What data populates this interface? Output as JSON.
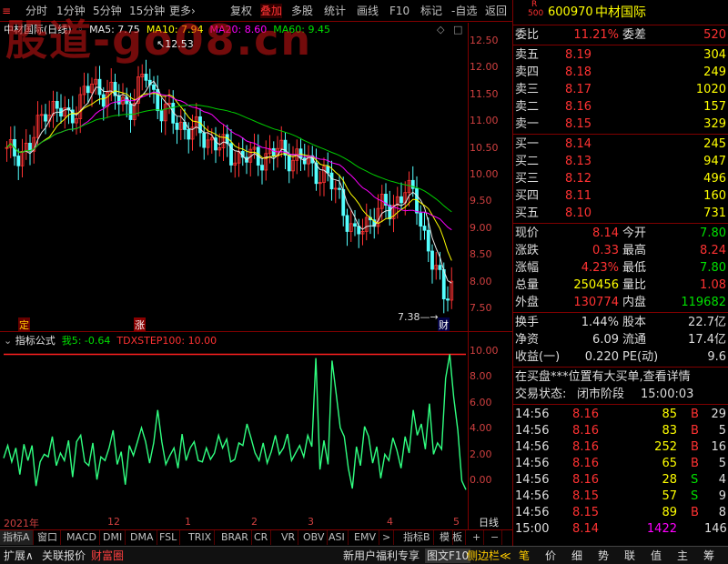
{
  "toolbar": {
    "items": [
      "分时",
      "1分钟",
      "5分钟",
      "15分钟",
      "更多›",
      "复权",
      "叠加",
      "多股",
      "统计",
      "画线",
      "F10",
      "标记",
      "-自选",
      "返回"
    ]
  },
  "chart": {
    "stock_title": "中材国际(日线)",
    "ma5": "MA5: 7.75",
    "ma10": "MA10: 7.94",
    "ma20": "MA20: 8.60",
    "ma60": "MA60: 9.45",
    "high_label": "12.53",
    "low_label": "7.38",
    "marker_ding": "定",
    "marker_zhang": "涨",
    "marker_cai": "财",
    "price_axis": [
      "12.50",
      "12.00",
      "11.50",
      "11.00",
      "10.50",
      "10.00",
      "9.50",
      "9.00",
      "8.50",
      "8.00",
      "7.50"
    ],
    "indicator_name": "指标公式",
    "indicator_values": "我5: -0.64",
    "indicator_step": "TDXSTEP100: 10.00",
    "indicator_axis": [
      "10.00",
      "8.00",
      "6.00",
      "4.00",
      "2.00",
      "0.00"
    ],
    "date_labels": [
      "2021年",
      "12",
      "1",
      "2",
      "3",
      "4",
      "5"
    ],
    "period": "日线",
    "watermark": "股道-go08.cn"
  },
  "chart_data": {
    "type": "line",
    "price_ylim": [
      7.3,
      12.7
    ],
    "indicator": {
      "name": "我5",
      "values": [
        1.8,
        2.8,
        1.5,
        2.6,
        0.5,
        2.9,
        1.6,
        2.8,
        -0.4,
        1.5,
        2.1,
        1.9,
        3.5,
        1.2,
        2.2,
        1.6,
        3.2,
        0.3,
        3.1,
        3.6,
        1.5,
        1.2,
        3.0,
        0.1,
        1.9,
        1.6,
        2.6,
        4.0,
        1.3,
        2.3,
        -0.3,
        2.8,
        2.0,
        3.1,
        4.2,
        3.1,
        1.4,
        3.0,
        5.6,
        3.1,
        1.3,
        2.0,
        2.6,
        1.0,
        3.7,
        1.6,
        2.6,
        3.1,
        1.6,
        1.5,
        2.6,
        1.7,
        2.2,
        3.6,
        2.6,
        3.3,
        1.5,
        1.7,
        3.0,
        2.8,
        4.5,
        3.4,
        2.2,
        1.6,
        3.0,
        1.4,
        2.3,
        3.6,
        2.1,
        2.6,
        3.7,
        1.6,
        2.2,
        2.8,
        1.9,
        3.6,
        2.7,
        9.7,
        0.9,
        3.2,
        1.3,
        9.5,
        6.9,
        4.2,
        3.5,
        1.0,
        -0.6,
        2.7,
        1.2,
        4.3,
        3.5,
        1.4,
        2.7,
        0.2,
        2.1,
        1.6,
        3.4,
        2.4,
        1.0,
        3.5,
        2.2,
        5.6,
        3.6,
        4.5,
        2.5,
        6.1,
        2.1,
        3.0,
        2.5,
        8.1,
        10.0,
        6.6,
        4.0,
        0.0,
        -0.7
      ],
      "ylim": [
        -2.4,
        11.4
      ]
    },
    "step_line": 10.0
  },
  "quote": {
    "code": "600970",
    "name": "中材国际",
    "rlabel": "R",
    "r500": "500",
    "weibi_label": "委比",
    "weibi": "11.21%",
    "weicha_label": "委差",
    "weicha": "520",
    "sell": [
      {
        "l": "卖五",
        "p": "8.19",
        "v": "304"
      },
      {
        "l": "卖四",
        "p": "8.18",
        "v": "249"
      },
      {
        "l": "卖三",
        "p": "8.17",
        "v": "1020"
      },
      {
        "l": "卖二",
        "p": "8.16",
        "v": "157"
      },
      {
        "l": "卖一",
        "p": "8.15",
        "v": "329"
      }
    ],
    "buy": [
      {
        "l": "买一",
        "p": "8.14",
        "v": "245"
      },
      {
        "l": "买二",
        "p": "8.13",
        "v": "947"
      },
      {
        "l": "买三",
        "p": "8.12",
        "v": "496"
      },
      {
        "l": "买四",
        "p": "8.11",
        "v": "160"
      },
      {
        "l": "买五",
        "p": "8.10",
        "v": "731"
      }
    ],
    "xianjia_l": "现价",
    "xianjia": "8.14",
    "jinkai_l": "今开",
    "jinkai": "7.80",
    "zhangdie_l": "涨跌",
    "zhangdie": "0.33",
    "zuigao_l": "最高",
    "zuigao": "8.24",
    "zhangfu_l": "涨幅",
    "zhangfu": "4.23%",
    "zuidi_l": "最低",
    "zuidi": "7.80",
    "zongliang_l": "总量",
    "zongliang": "250456",
    "liangbi_l": "量比",
    "liangbi": "1.08",
    "waipan_l": "外盘",
    "waipan": "130774",
    "neipan_l": "内盘",
    "neipan": "119682",
    "huanshou_l": "换手",
    "huanshou": "1.44%",
    "guben_l": "股本",
    "guben": "22.7亿",
    "jingzi_l": "净资",
    "jingzi": "6.09",
    "liutong_l": "流通",
    "liutong": "17.4亿",
    "shouyi_l": "收益(一)",
    "shouyi": "0.220",
    "pe_l": "PE(动)",
    "pe": "9.6",
    "notice": "在买盘***位置有大买单,查看详情",
    "trade_state_l": "交易状态:",
    "trade_state": "闭市阶段",
    "trade_time": "15:00:03",
    "ticks": [
      {
        "t": "14:56",
        "p": "8.16",
        "v": "85",
        "d": "B",
        "n": "29"
      },
      {
        "t": "14:56",
        "p": "8.16",
        "v": "83",
        "d": "B",
        "n": "5"
      },
      {
        "t": "14:56",
        "p": "8.16",
        "v": "252",
        "d": "B",
        "n": "16"
      },
      {
        "t": "14:56",
        "p": "8.16",
        "v": "65",
        "d": "B",
        "n": "5"
      },
      {
        "t": "14:56",
        "p": "8.16",
        "v": "28",
        "d": "S",
        "n": "4"
      },
      {
        "t": "14:56",
        "p": "8.15",
        "v": "57",
        "d": "S",
        "n": "9"
      },
      {
        "t": "14:56",
        "p": "8.15",
        "v": "89",
        "d": "B",
        "n": "8"
      },
      {
        "t": "15:00",
        "p": "8.14",
        "v": "1422",
        "d": "",
        "n": "146"
      }
    ]
  },
  "tabs": [
    "指标A",
    "窗口",
    "MACD",
    "DMI",
    "DMA",
    "FSL",
    "TRIX",
    "BRAR",
    "CR",
    "VR",
    "OBV",
    "ASI",
    "EMV",
    ">",
    "指标B",
    "模",
    "板",
    "+",
    "−"
  ],
  "status": {
    "left": [
      "扩展∧",
      "关联报价",
      "财富圈"
    ],
    "mid": [
      "新用户福利专享",
      "图文F10",
      "侧边栏≪"
    ],
    "right": [
      "笔",
      "价",
      "细",
      "势",
      "联",
      "值",
      "主",
      "筹"
    ]
  }
}
